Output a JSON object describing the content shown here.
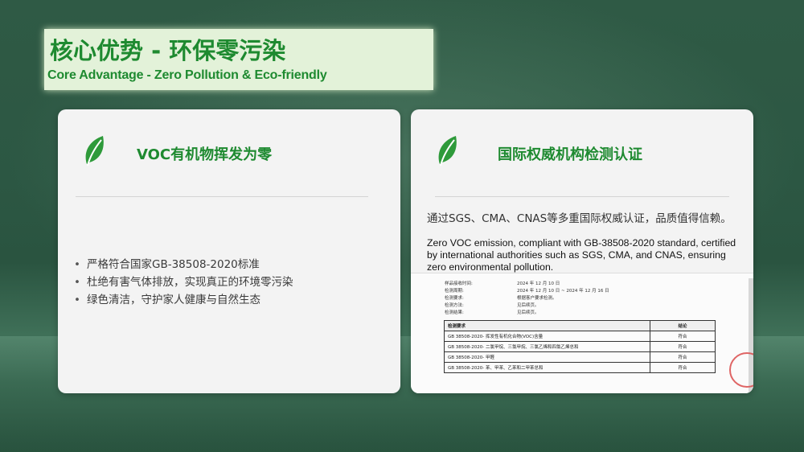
{
  "header": {
    "title_cn": "核心优势 - 环保零污染",
    "title_en": "Core Advantage - Zero Pollution & Eco-friendly"
  },
  "left_card": {
    "icon": "leaf-icon",
    "title": "VOC有机物挥发为零",
    "bullets": [
      "严格符合国家GB-38508-2020标准",
      "杜绝有害气体排放，实现真正的环境零污染",
      "绿色清洁，守护家人健康与自然生态"
    ]
  },
  "right_card": {
    "icon": "leaf-icon",
    "title": "国际权威机构检测认证",
    "desc_cn": "通过SGS、CMA、CNAS等多重国际权威认证，品质值得信赖。",
    "desc_en": "Zero VOC emission, compliant with GB-38508-2020 standard, certified by international authorities such as SGS, CMA, and CNAS, ensuring zero environmental pollution.",
    "certificate": {
      "info": [
        {
          "label": "样品接收时间:",
          "value": "2024 年 12 月 10 日"
        },
        {
          "label": "检测周期:",
          "value": "2024 年 12 月 10 日 ~ 2024 年 12 月 16 日"
        },
        {
          "label": "检测要求:",
          "value": "根据客户要求检测。"
        },
        {
          "label": "检测方法:",
          "value": "见后续页。"
        },
        {
          "label": "检测结果:",
          "value": "见后续页。"
        }
      ],
      "table_header": {
        "requirement": "检测要求",
        "conclusion": "结论"
      },
      "rows": [
        {
          "requirement": "GB 38508-2020- 挥发性有机化合物(VOC)含量",
          "conclusion": "符合"
        },
        {
          "requirement": "GB 38508-2020- 二氯甲烷、三氯甲烷、三氯乙烯和四氯乙烯总和",
          "conclusion": "符合"
        },
        {
          "requirement": "GB 38508-2020- 甲醛",
          "conclusion": "符合"
        },
        {
          "requirement": "GB 38508-2020- 苯、甲苯、乙苯和二甲苯总和",
          "conclusion": "符合"
        }
      ]
    }
  },
  "colors": {
    "accent_green": "#1e8a30",
    "title_bg": "#e3f2d9",
    "card_bg": "#f3f3f3",
    "stamp_red": "#d94a4a"
  }
}
